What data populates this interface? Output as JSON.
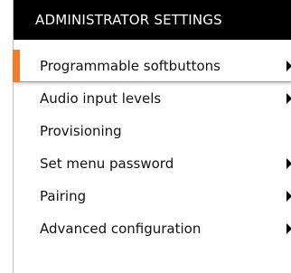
{
  "header": {
    "title": "ADMINISTRATOR SETTINGS"
  },
  "colors": {
    "header_background": "#000000",
    "header_text": "#ffffff",
    "selection_accent": "#f07d2b",
    "item_text": "#111111",
    "arrow": "#000000"
  },
  "menu": {
    "items": [
      {
        "label": "Programmable softbuttons",
        "has_submenu": true,
        "selected": true,
        "arrow_icon": "triangle-right-icon"
      },
      {
        "label": "Audio input levels",
        "has_submenu": true,
        "selected": false,
        "arrow_icon": "triangle-right-icon"
      },
      {
        "label": "Provisioning",
        "has_submenu": false,
        "selected": false
      },
      {
        "label": "Set menu password",
        "has_submenu": true,
        "selected": false,
        "arrow_icon": "triangle-right-icon"
      },
      {
        "label": "Pairing",
        "has_submenu": true,
        "selected": false,
        "arrow_icon": "triangle-right-icon"
      },
      {
        "label": "Advanced configuration",
        "has_submenu": true,
        "selected": false,
        "arrow_icon": "triangle-right-icon"
      }
    ]
  }
}
